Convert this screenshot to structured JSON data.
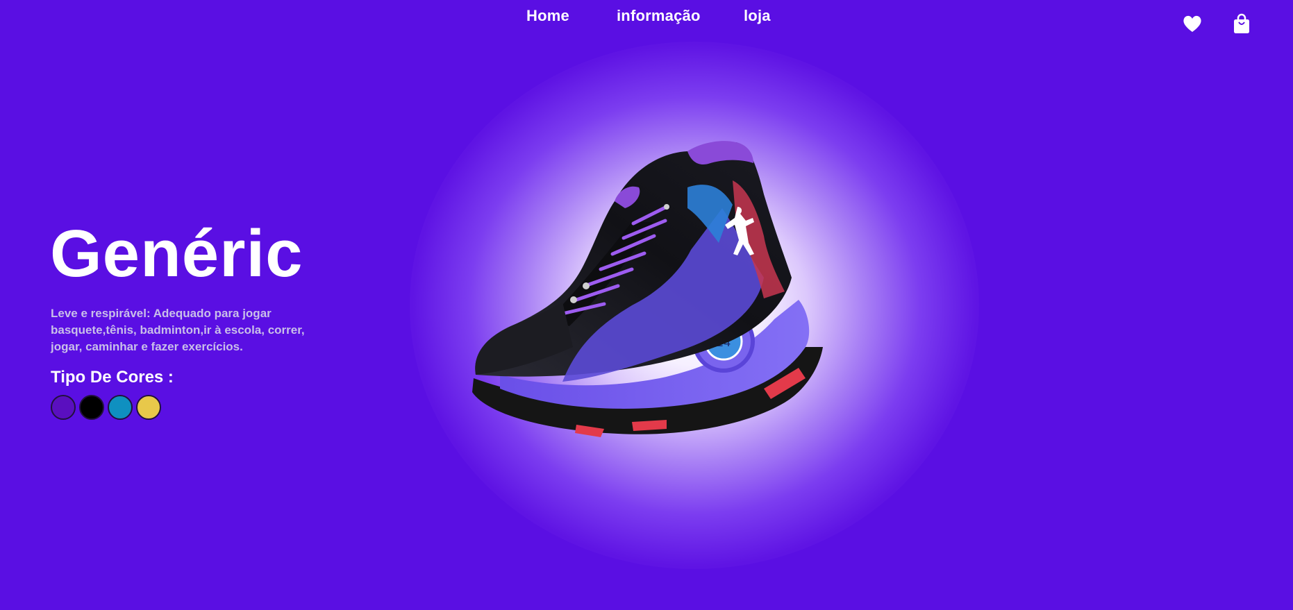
{
  "nav": {
    "home": "Home",
    "info": "informação",
    "shop": "loja"
  },
  "icons": {
    "favorite": "heart-icon",
    "cart": "shopping-bag-icon"
  },
  "hero": {
    "title": "Genéric",
    "description": "Leve e respirável: Adequado para jogar basquete,tênis, badminton,ir à escola, correr, jogar, caminhar e fazer exercícios.",
    "colors_title": "Tipo De Cores :",
    "colors": [
      "#5a0fbf",
      "#000000",
      "#0f90c0",
      "#e8c84a"
    ]
  },
  "theme": {
    "background": "#5a0fe3",
    "text": "#ffffff",
    "muted_text": "#c9bfe9"
  }
}
